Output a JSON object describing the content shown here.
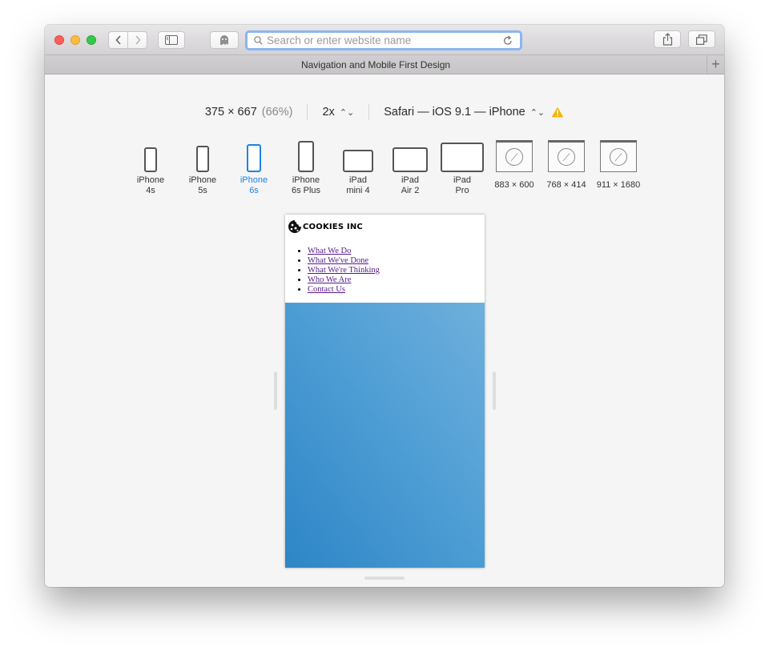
{
  "browser": {
    "url_placeholder": "Search or enter website name",
    "tab_title": "Navigation and Mobile First Design",
    "new_tab_label": "+",
    "colors": {
      "accent": "#1d82e8",
      "close": "#fc605b",
      "minimize": "#fdbc40",
      "maximize": "#34c84a",
      "warning": "#f5b400"
    }
  },
  "responsive": {
    "dimensions": "375 × 667",
    "zoom": "(66%)",
    "scale": "2x",
    "user_agent": "Safari — iOS 9.1 — iPhone",
    "devices": [
      {
        "label": "iPhone\n4s",
        "kind": "phone",
        "active": false
      },
      {
        "label": "iPhone\n5s",
        "kind": "phone",
        "active": false
      },
      {
        "label": "iPhone\n6s",
        "kind": "phone",
        "active": true
      },
      {
        "label": "iPhone\n6s Plus",
        "kind": "phone",
        "active": false
      },
      {
        "label": "iPad\nmini 4",
        "kind": "tablet",
        "active": false
      },
      {
        "label": "iPad\nAir 2",
        "kind": "tablet",
        "active": false
      },
      {
        "label": "iPad\nPro",
        "kind": "tablet",
        "active": false
      },
      {
        "label": "883 × 600",
        "kind": "desktop",
        "active": false
      },
      {
        "label": "768 × 414",
        "kind": "desktop",
        "active": false
      },
      {
        "label": "911 × 1680",
        "kind": "desktop",
        "active": false
      }
    ]
  },
  "site": {
    "logo_text": "COOKIES INC",
    "nav": [
      "What We Do",
      "What We've Done",
      "What We're Thinking",
      "Who We Are",
      "Contact Us"
    ],
    "hero_colors": [
      "#2d86c5",
      "#6eb0dc"
    ]
  }
}
